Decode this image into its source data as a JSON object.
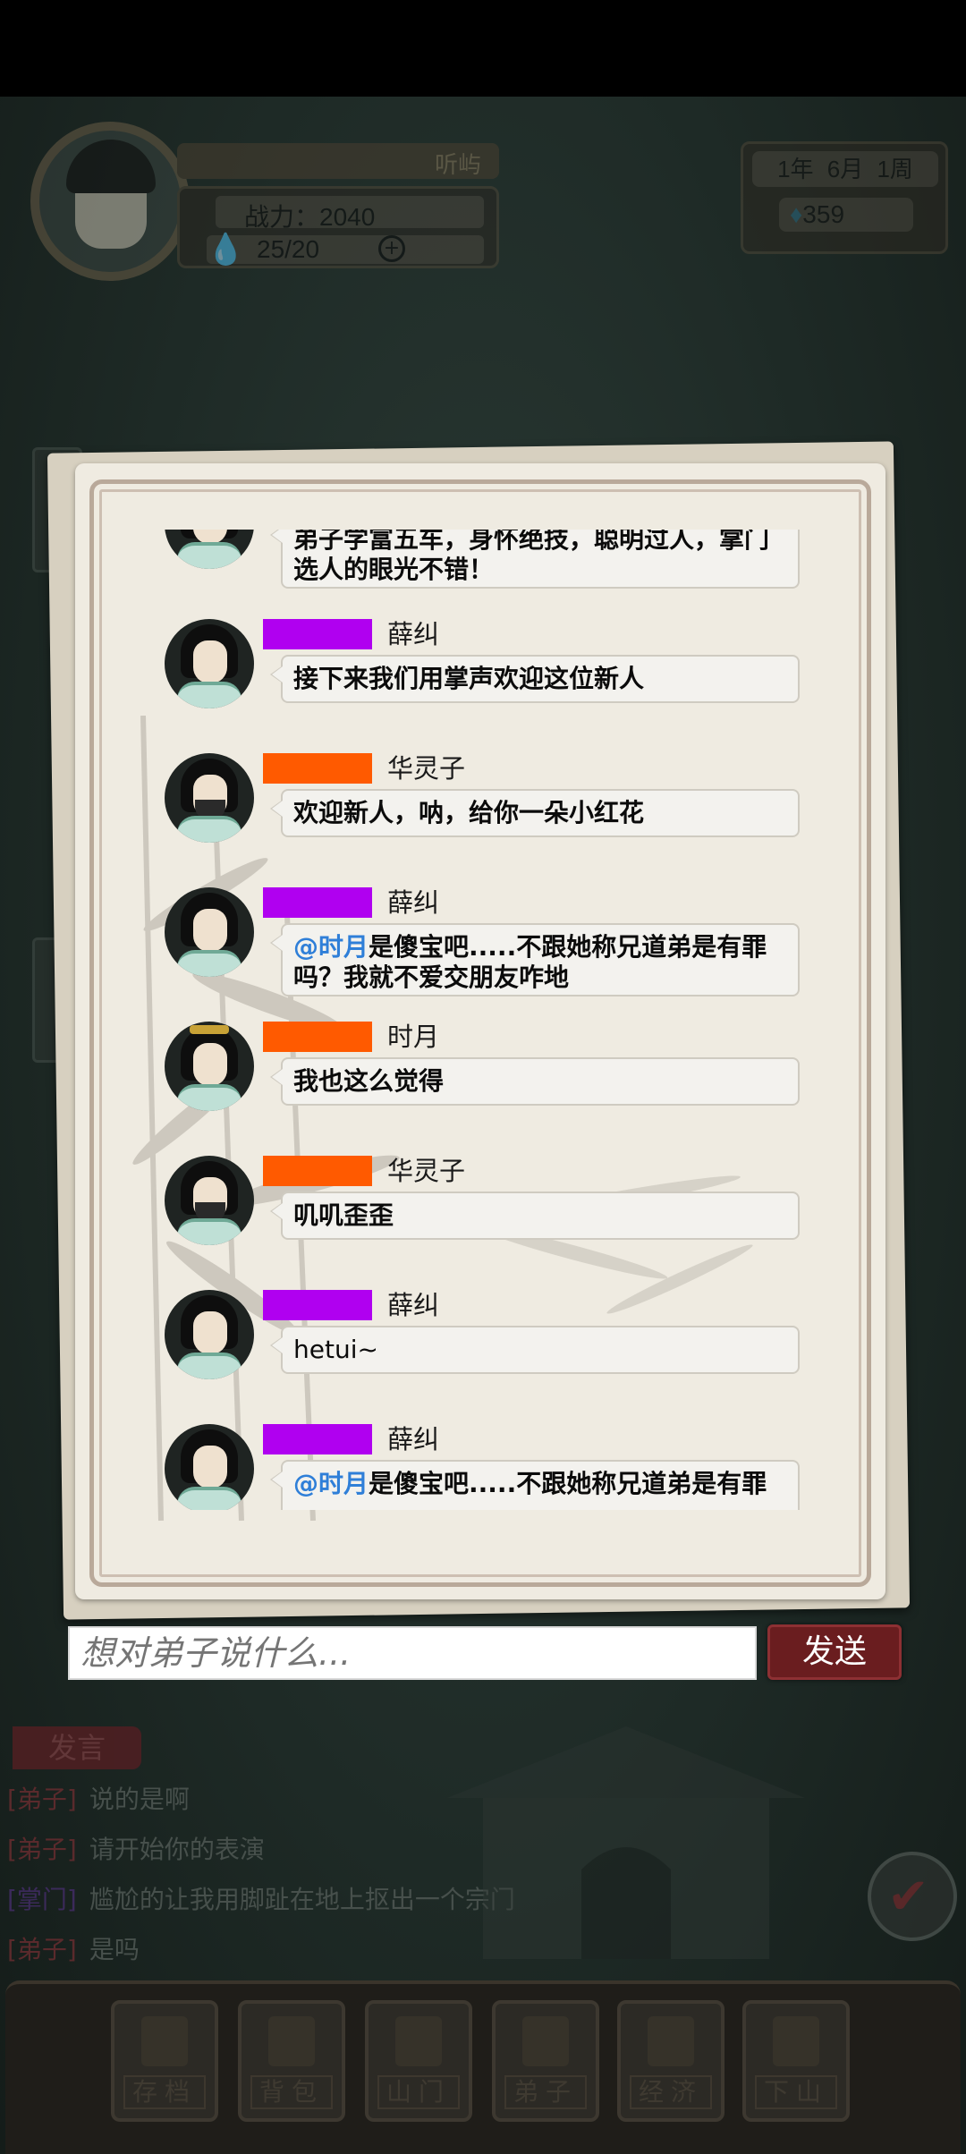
{
  "hud": {
    "player_name": "听屿",
    "power_label": "战力：2040",
    "stamina": "25/20",
    "date": "1年  6月  1周",
    "spirit_stones": "359"
  },
  "chat": {
    "messages": [
      {
        "sender": "",
        "tag_color": "#000000",
        "text": "弟子学富五车，身怀绝技，聪明过人，掌门选人的眼光不错！",
        "mention": ""
      },
      {
        "sender": "薛纠",
        "tag_color": "#b000f0",
        "text": "接下来我们用掌声欢迎这位新人",
        "mention": ""
      },
      {
        "sender": "华灵子",
        "tag_color": "#ff5a00",
        "text": "欢迎新人，呐，给你一朵小红花",
        "mention": ""
      },
      {
        "sender": "薛纠",
        "tag_color": "#b000f0",
        "text": "是傻宝吧.....不跟她称兄道弟是有罪吗？我就不爱交朋友咋地",
        "mention": "@时月"
      },
      {
        "sender": "时月",
        "tag_color": "#ff5a00",
        "text": "我也这么觉得",
        "mention": ""
      },
      {
        "sender": "华灵子",
        "tag_color": "#ff5a00",
        "text": "叽叽歪歪",
        "mention": ""
      },
      {
        "sender": "薛纠",
        "tag_color": "#b000f0",
        "text": "hetui~",
        "mention": ""
      },
      {
        "sender": "薛纠",
        "tag_color": "#b000f0",
        "text": "是傻宝吧.....不跟她称兄道弟是有罪",
        "mention": "@时月"
      }
    ]
  },
  "input": {
    "placeholder": "想对弟子说什么..."
  },
  "send_label": "发送",
  "log": {
    "title": "发言",
    "lines": [
      {
        "who": "[弟子]",
        "text": "说的是啊"
      },
      {
        "who": "[弟子]",
        "text": "请开始你的表演"
      },
      {
        "who": "[掌门]",
        "text": "尴尬的让我用脚趾在地上抠出一个宗门"
      },
      {
        "who": "[弟子]",
        "text": "是吗"
      }
    ]
  },
  "nav": [
    "存档",
    "背包",
    "山门",
    "弟子",
    "经济",
    "下山"
  ]
}
